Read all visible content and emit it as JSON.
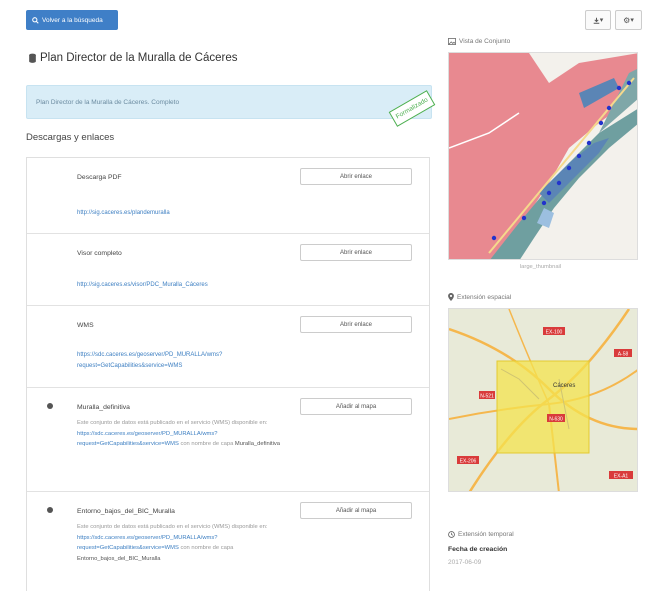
{
  "toolbar": {
    "back_label": "Volver a la búsqueda",
    "download_label": "▾",
    "settings_label": "▾"
  },
  "page": {
    "title": "Plan Director de la Muralla de Cáceres",
    "notice": "Plan Director de la Muralla de Cáceres. Completo",
    "stamp": "Formalizado"
  },
  "downloads": {
    "title": "Descargas y enlaces",
    "items": [
      {
        "name": "Descarga PDF",
        "button": "Abrir enlace",
        "url": "http://sig.caceres.es/plandemuralla"
      },
      {
        "name": "Visor completo",
        "button": "Abrir enlace",
        "url": "http://sig.caceres.es/visor/PDC_Muralla_Cáceres"
      },
      {
        "name": "WMS",
        "button": "Abrir enlace",
        "url": "https://sdc.caceres.es/geoserver/PD_MURALLA/wms?request=GetCapabilities&service=WMS"
      },
      {
        "name": "Muralla_definitiva",
        "button": "Añadir al mapa",
        "desc_pre": "Este conjunto de datos está publicado en el servicio (WMS) disponible en:",
        "desc_url": "https://sdc.caceres.es/geoserver/PD_MURALLA/wms?request=GetCapabilities&service=WMS",
        "desc_mid": "con nombre de capa",
        "desc_layer": "Muralla_definitiva"
      },
      {
        "name": "Entorno_bajos_del_BIC_Muralla",
        "button": "Añadir al mapa",
        "desc_pre": "Este conjunto de datos está publicado en el servicio (WMS) disponible en:",
        "desc_url": "https://sdc.caceres.es/geoserver/PD_MURALLA/wms?request=GetCapabilities&service=WMS",
        "desc_mid": "con nombre de capa",
        "desc_layer": "Entorno_bajos_del_BIC_Muralla"
      }
    ]
  },
  "sidebar": {
    "preview_label": "Vista de Conjunto",
    "preview_caption": "large_thumbnail",
    "spatial_label": "Extensión espacial",
    "temporal_label": "Extensión temporal",
    "creation_label": "Fecha de creación",
    "creation_value": "2017-06-09",
    "map_labels": [
      "Cáceres",
      "EX-100",
      "N-521",
      "N-630",
      "A-58",
      "EX-206",
      "EX-A1"
    ]
  },
  "colors": {
    "primary": "#3f7fc7",
    "notice_bg": "#d9edf7",
    "stamp": "#4caf50",
    "link": "#3d7fc2",
    "heritage_red": "#e88990",
    "extent_yellow": "#f4e34f"
  }
}
